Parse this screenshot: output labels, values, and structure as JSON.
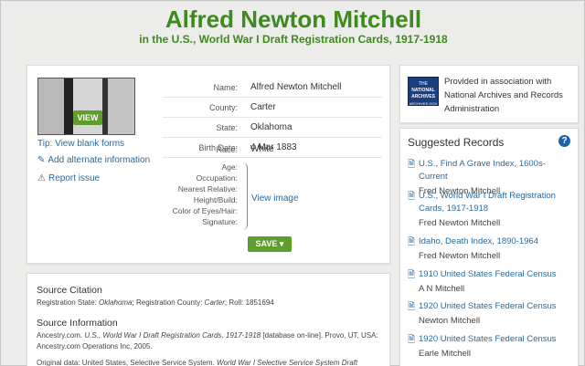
{
  "header": {
    "title": "Alfred Newton Mitchell",
    "subtitle": "in the U.S., World War I Draft Registration Cards, 1917-1918"
  },
  "record": {
    "view_button": "VIEW",
    "links": {
      "blank_forms": "Tip: View blank forms",
      "alternate": "Add alternate information",
      "report": "Report issue"
    },
    "fields": [
      {
        "label": "Name:",
        "value": "Alfred Newton Mitchell"
      },
      {
        "label": "County:",
        "value": "Carter"
      },
      {
        "label": "State:",
        "value": "Oklahoma"
      },
      {
        "label": "Birth Date:",
        "value": "4 Mar 1883"
      },
      {
        "label": "Race:",
        "value": "White"
      }
    ],
    "image_fields": [
      "Age:",
      "Occupation:",
      "Nearest Relative:",
      "Height/Build:",
      "Color of Eyes/Hair:",
      "Signature:"
    ],
    "view_image": "View image",
    "save_button": "SAVE"
  },
  "source": {
    "citation_heading": "Source Citation",
    "citation_prefix": "Registration State: ",
    "citation_state": "Oklahoma",
    "citation_mid": "; Registration County: ",
    "citation_county": "Carter",
    "citation_suffix": "; Roll: 1851694",
    "info_heading": "Source Information",
    "info_prefix": "Ancestry.com. ",
    "info_title": "U.S., World War I Draft Registration Cards, 1917-1918",
    "info_suffix": " [database on-line]. Provo, UT, USA: Ancestry.com Operations Inc, 2005.",
    "original_prefix": "Original data: United States, Selective Service System. ",
    "original_title": "World War I Selective Service System Draft"
  },
  "association": {
    "logo_line1": "THE",
    "logo_line2": "NATIONAL",
    "logo_line3": "ARCHIVES",
    "logo_line4": "ARCHIVES.GOV",
    "text": "Provided in association with National Archives and Records Administration"
  },
  "suggested": {
    "title": "Suggested Records",
    "help": "?",
    "items": [
      {
        "link": "U.S., Find A Grave Index, 1600s-Current",
        "person": "Fred Newton Mitchell"
      },
      {
        "link": "U.S., World War I Draft Registration Cards, 1917-1918",
        "person": "Fred Newton Mitchell"
      },
      {
        "link": "Idaho, Death Index, 1890-1964",
        "person": "Fred Newton Mitchell"
      },
      {
        "link": "1910 United States Federal Census",
        "person": "A N Mitchell"
      },
      {
        "link": "1920 United States Federal Census",
        "person": "Newton Mitchell"
      },
      {
        "link": "1920 United States Federal Census",
        "person": "Earle Mitchell"
      }
    ]
  },
  "colors": {
    "brand_green": "#3d8a1e",
    "button_green": "#5f9e2c",
    "link_blue": "#2a6a9c"
  }
}
